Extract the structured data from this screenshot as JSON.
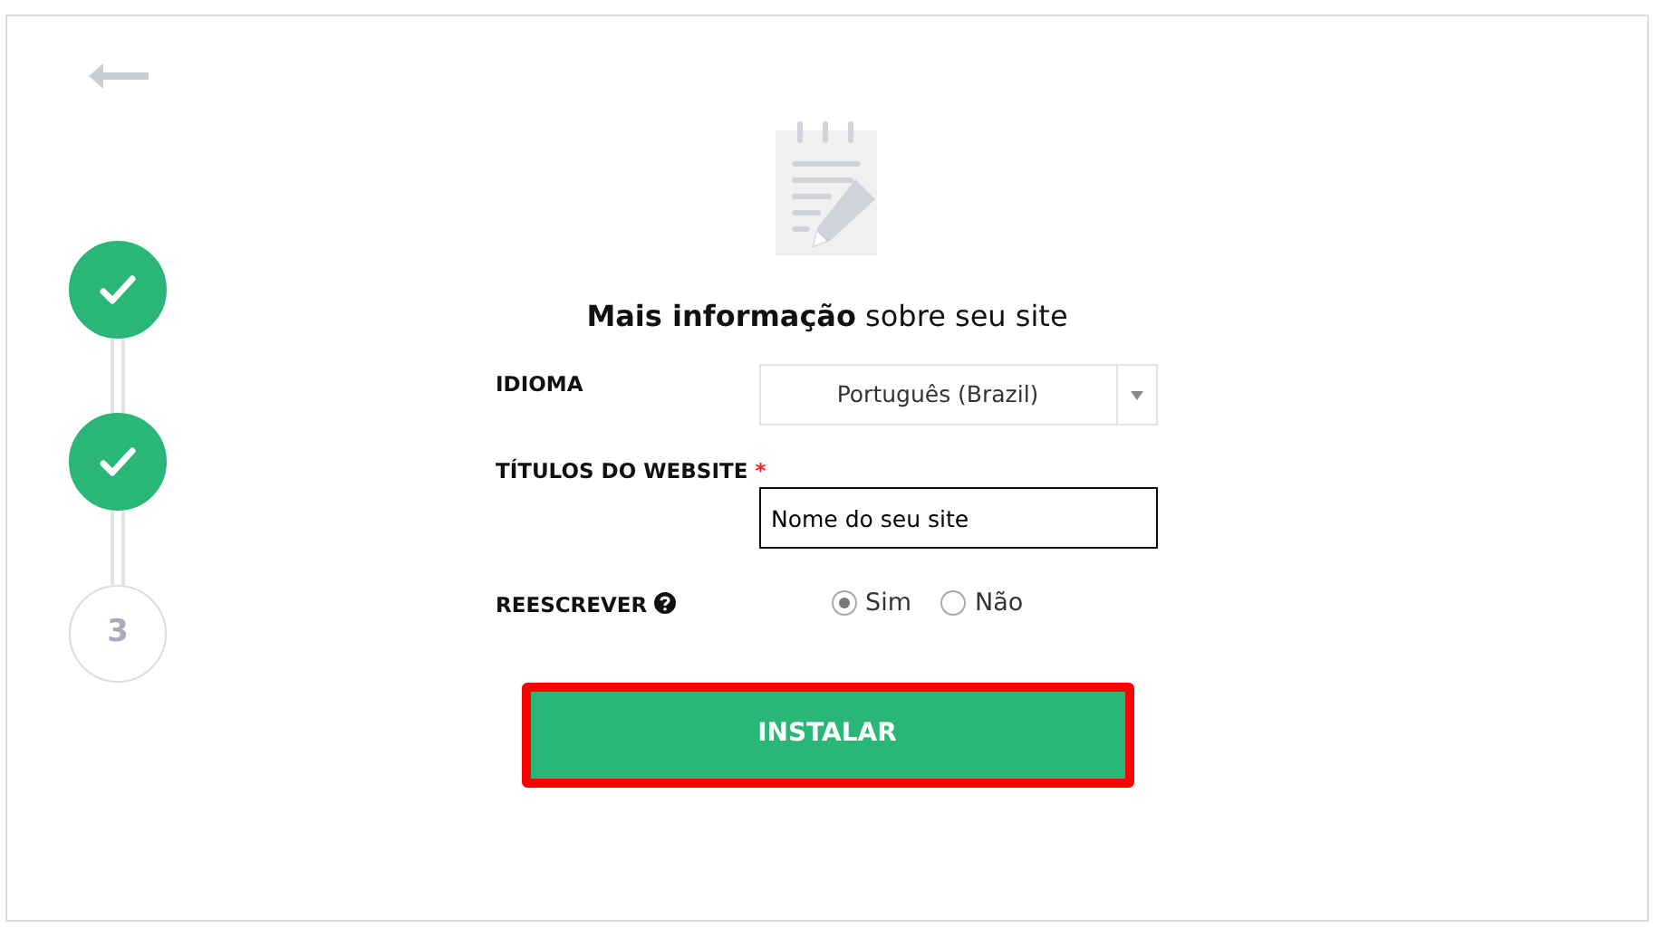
{
  "steps": [
    {
      "done": true
    },
    {
      "done": true
    },
    {
      "label": "3",
      "done": false
    }
  ],
  "heading": "**Mais informação** sobre seu site",
  "fields": [
    {
      "kind": "select",
      "label": "IDIOMA",
      "value": "Português (Brazil)"
    },
    {
      "kind": "text",
      "label": "TÍTULOS DO WEBSITE",
      "required_mark": "*",
      "value": "Nome do seu site"
    },
    {
      "kind": "radio",
      "label": "REESCREVER",
      "help": true,
      "options": [
        {
          "label": "Sim",
          "selected": true
        },
        {
          "label": "Não",
          "selected": false
        }
      ]
    }
  ],
  "submit": {
    "label": "INSTALAR",
    "highlighted": true
  }
}
